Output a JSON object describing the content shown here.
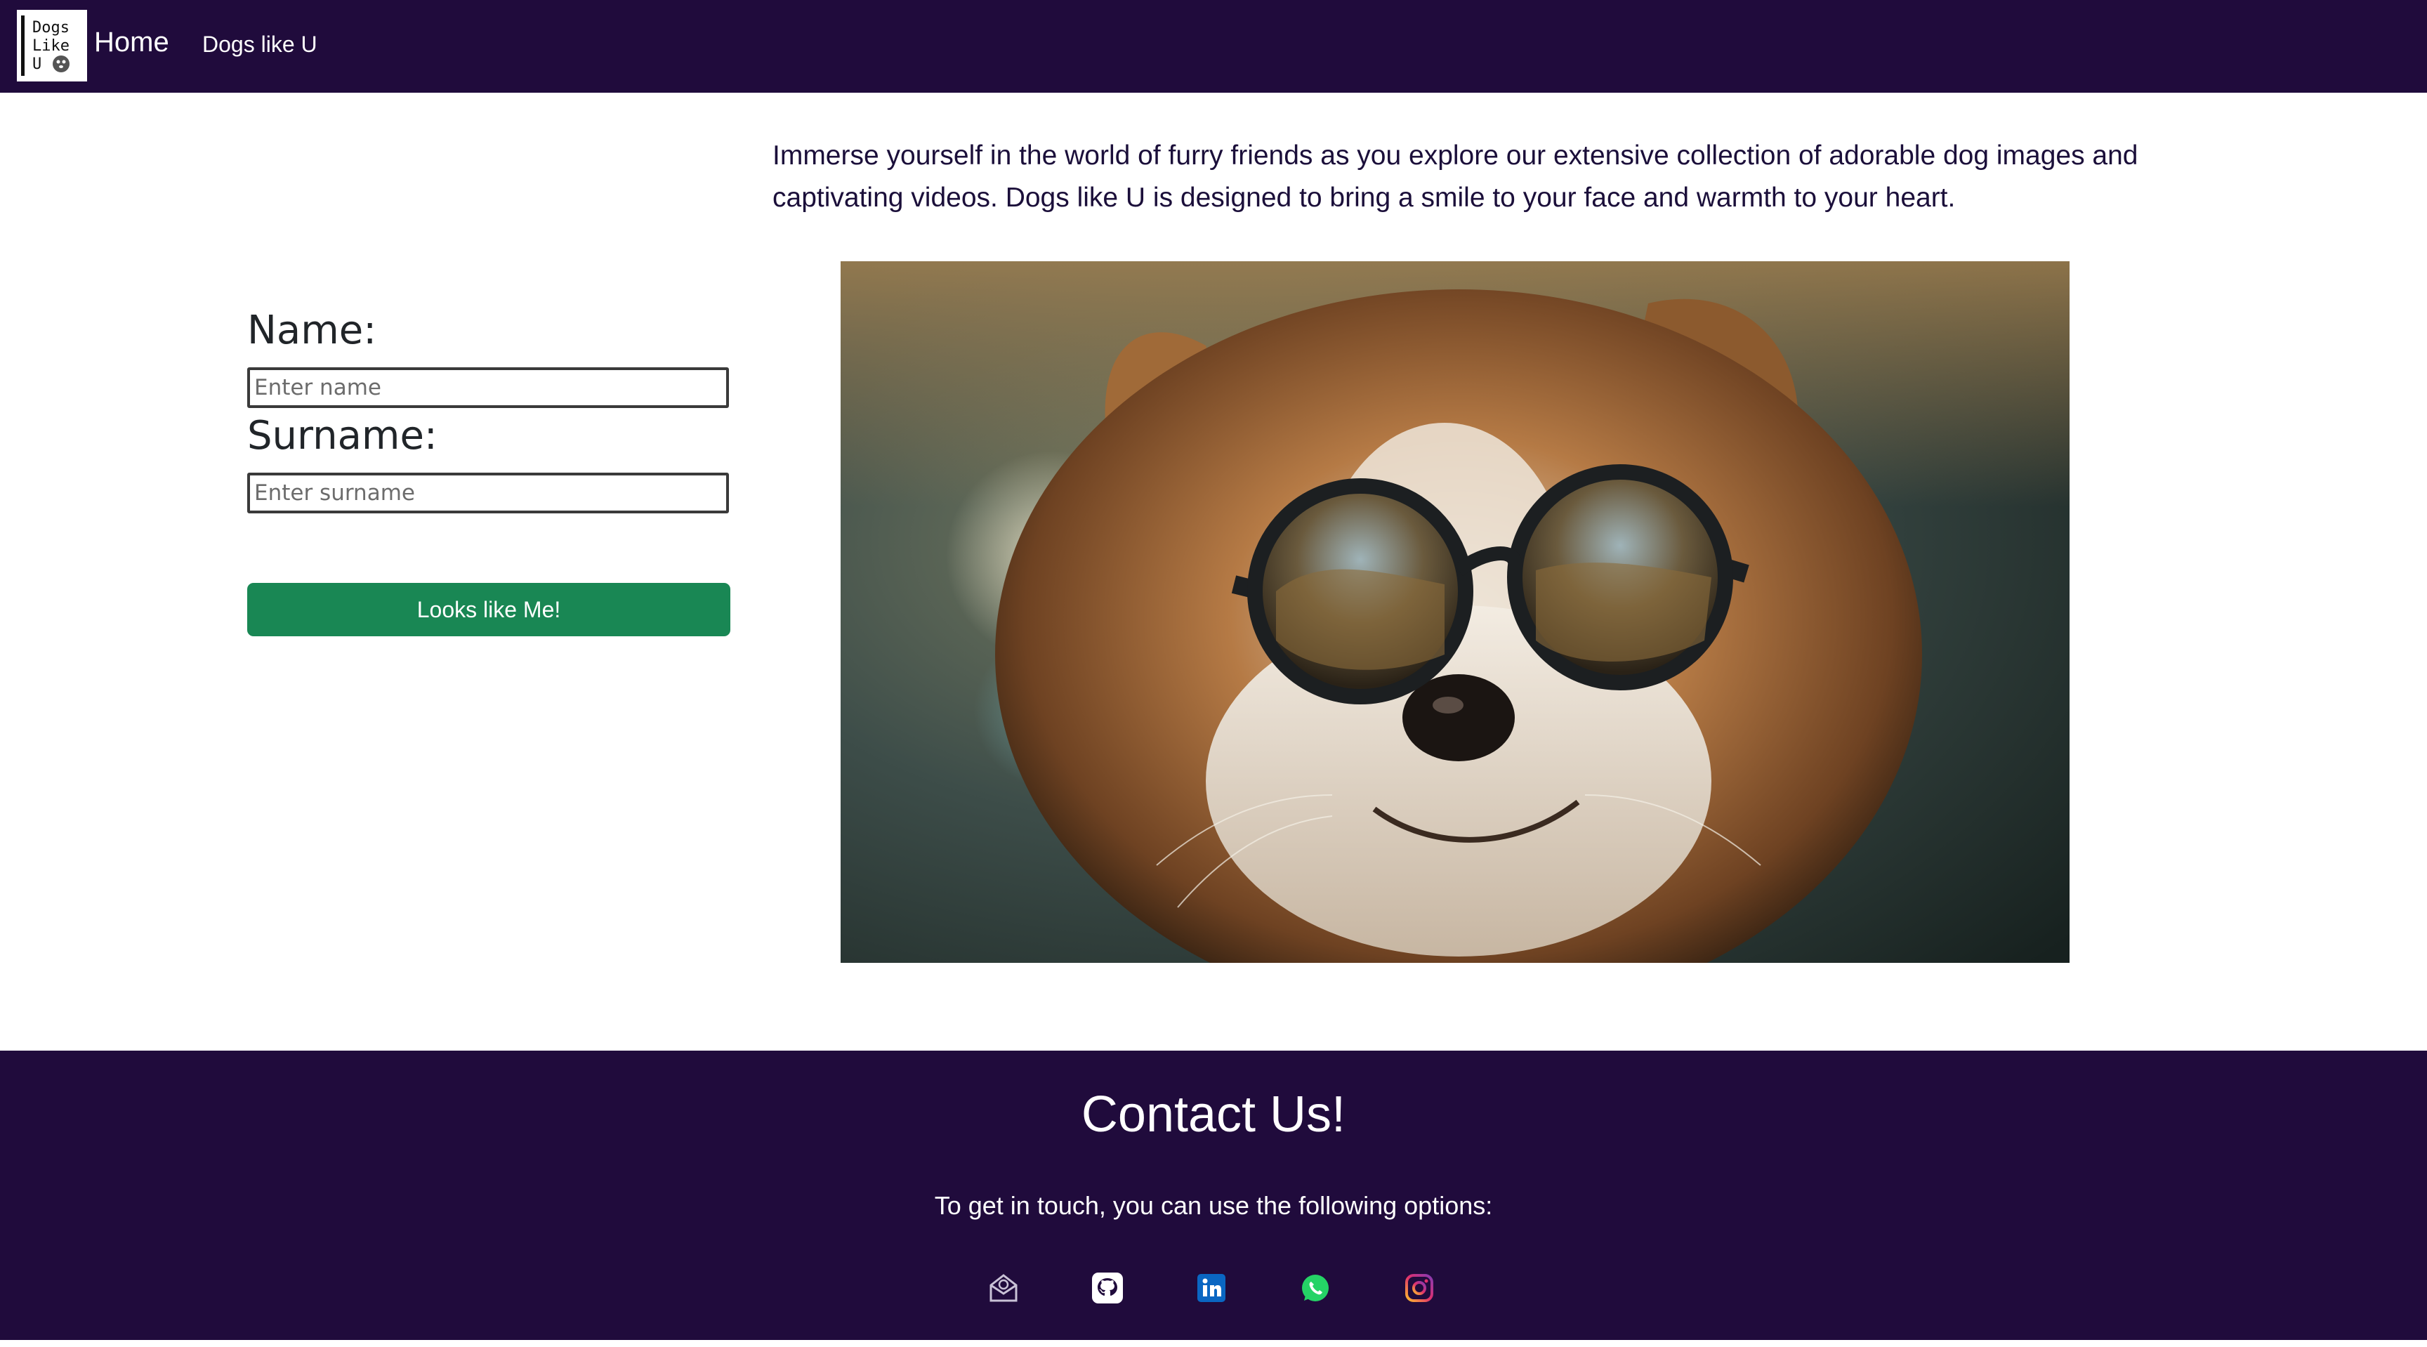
{
  "navbar": {
    "logo_text": [
      "Dogs",
      "Like",
      "U"
    ],
    "home_label": "Home",
    "brand_label": "Dogs like U",
    "background": "#200b3c"
  },
  "intro": {
    "text": "Immerse yourself in the world of furry friends as you explore our extensive collection of adorable dog images and captivating videos. Dogs like U is designed to bring a smile to your face and warmth to your heart."
  },
  "form": {
    "name_label": "Name:",
    "name_placeholder": "Enter name",
    "name_value": "",
    "surname_label": "Surname:",
    "surname_placeholder": "Enter surname",
    "surname_value": "",
    "submit_label": "Looks like Me!",
    "submit_color": "#198754"
  },
  "hero": {
    "subject": "dog-with-sunglasses-image"
  },
  "footer": {
    "title": "Contact Us!",
    "text": "To get in touch, you can use the following options:",
    "socials": [
      {
        "name": "email-icon",
        "color": "#c9c2d6"
      },
      {
        "name": "github-icon",
        "color": "#ffffff"
      },
      {
        "name": "linkedin-icon",
        "color": "#0a66c2"
      },
      {
        "name": "whatsapp-icon",
        "color": "#25d366"
      },
      {
        "name": "instagram-icon",
        "color": "#d6249f"
      }
    ]
  }
}
